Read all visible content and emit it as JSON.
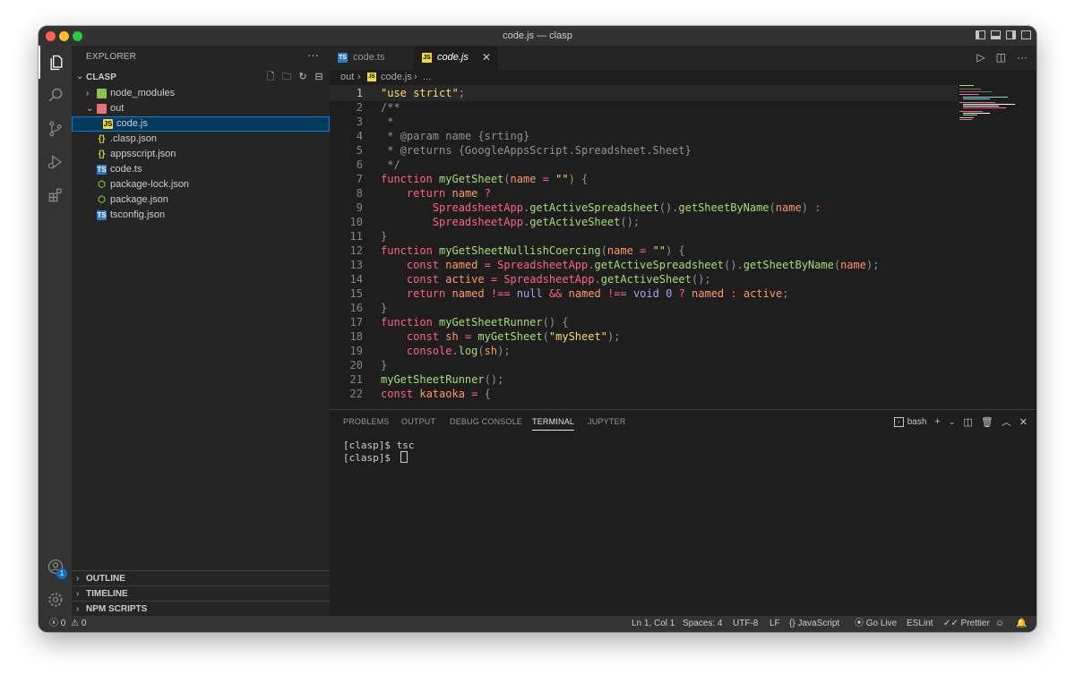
{
  "window": {
    "title": "code.js — clasp"
  },
  "colors": {
    "accent": "#007fd4",
    "badge": "#0e70c0",
    "selection": "#04395e",
    "editor_bg": "#1e1e1e",
    "statusbar_bg": "#333333"
  },
  "activity_bar": {
    "items": [
      {
        "icon": "files-icon"
      },
      {
        "icon": "search-icon"
      },
      {
        "icon": "source-control-icon"
      },
      {
        "icon": "run-debug-icon"
      },
      {
        "icon": "extensions-icon"
      }
    ],
    "account_badge": "1"
  },
  "sidebar": {
    "header": "EXPLORER",
    "more": "···",
    "project": "CLASP",
    "tree": [
      {
        "label": "node_modules",
        "indent": 1,
        "type": "folder",
        "expanded": false
      },
      {
        "label": "out",
        "indent": 1,
        "type": "folder",
        "expanded": true
      },
      {
        "label": "code.js",
        "indent": 2,
        "type": "js",
        "selected": true
      },
      {
        "label": ".clasp.json",
        "indent": 1,
        "type": "json"
      },
      {
        "label": "appsscript.json",
        "indent": 1,
        "type": "json"
      },
      {
        "label": "code.ts",
        "indent": 1,
        "type": "ts"
      },
      {
        "label": "package-lock.json",
        "indent": 1,
        "type": "node"
      },
      {
        "label": "package.json",
        "indent": 1,
        "type": "node"
      },
      {
        "label": "tsconfig.json",
        "indent": 1,
        "type": "tsconfig"
      }
    ],
    "sections": [
      "OUTLINE",
      "TIMELINE",
      "NPM SCRIPTS"
    ]
  },
  "tabs": [
    {
      "label": "code.ts",
      "icon_text": "TS",
      "active": false
    },
    {
      "label": "code.js",
      "icon_text": "JS",
      "active": true
    }
  ],
  "breadcrumb": {
    "folder": "out",
    "file": "code.js",
    "more": "..."
  },
  "editor": {
    "current_line": 1,
    "lines": [
      {
        "n": "1",
        "text": "\"use strict\";"
      },
      {
        "n": "2",
        "text": "/**"
      },
      {
        "n": "3",
        "text": " *"
      },
      {
        "n": "4",
        "text": " * @param name {srting}"
      },
      {
        "n": "5",
        "text": " * @returns {GoogleAppsScript.Spreadsheet.Sheet}"
      },
      {
        "n": "6",
        "text": " */"
      },
      {
        "n": "7",
        "text": "function myGetSheet(name = \"\") {"
      },
      {
        "n": "8",
        "text": "    return name ?"
      },
      {
        "n": "9",
        "text": "        SpreadsheetApp.getActiveSpreadsheet().getSheetByName(name) :"
      },
      {
        "n": "10",
        "text": "        SpreadsheetApp.getActiveSheet();"
      },
      {
        "n": "11",
        "text": "}"
      },
      {
        "n": "12",
        "text": "function myGetSheetNullishCoercing(name = \"\") {"
      },
      {
        "n": "13",
        "text": "    const named = SpreadsheetApp.getActiveSpreadsheet().getSheetByName(name);"
      },
      {
        "n": "14",
        "text": "    const active = SpreadsheetApp.getActiveSheet();"
      },
      {
        "n": "15",
        "text": "    return named !== null && named !== void 0 ? named : active;"
      },
      {
        "n": "16",
        "text": "}"
      },
      {
        "n": "17",
        "text": "function myGetSheetRunner() {"
      },
      {
        "n": "18",
        "text": "    const sh = myGetSheet(\"mySheet\");"
      },
      {
        "n": "19",
        "text": "    console.log(sh);"
      },
      {
        "n": "20",
        "text": "}"
      },
      {
        "n": "21",
        "text": "myGetSheetRunner();"
      },
      {
        "n": "22",
        "text": "const kataoka = {"
      }
    ]
  },
  "panel": {
    "tabs": [
      "PROBLEMS",
      "OUTPUT",
      "DEBUG CONSOLE",
      "TERMINAL",
      "JUPYTER"
    ],
    "active_tab": "TERMINAL",
    "shell": "bash",
    "terminal_lines": [
      "[clasp]$ tsc",
      "[clasp]$ "
    ]
  },
  "statusbar": {
    "errors": "0",
    "warnings": "0",
    "position": "Ln 1, Col 1",
    "spaces": "Spaces: 4",
    "encoding": "UTF-8",
    "eol": "LF",
    "language": "JavaScript",
    "golive": "Go Live",
    "eslint": "ESLint",
    "prettier": "Prettier"
  }
}
